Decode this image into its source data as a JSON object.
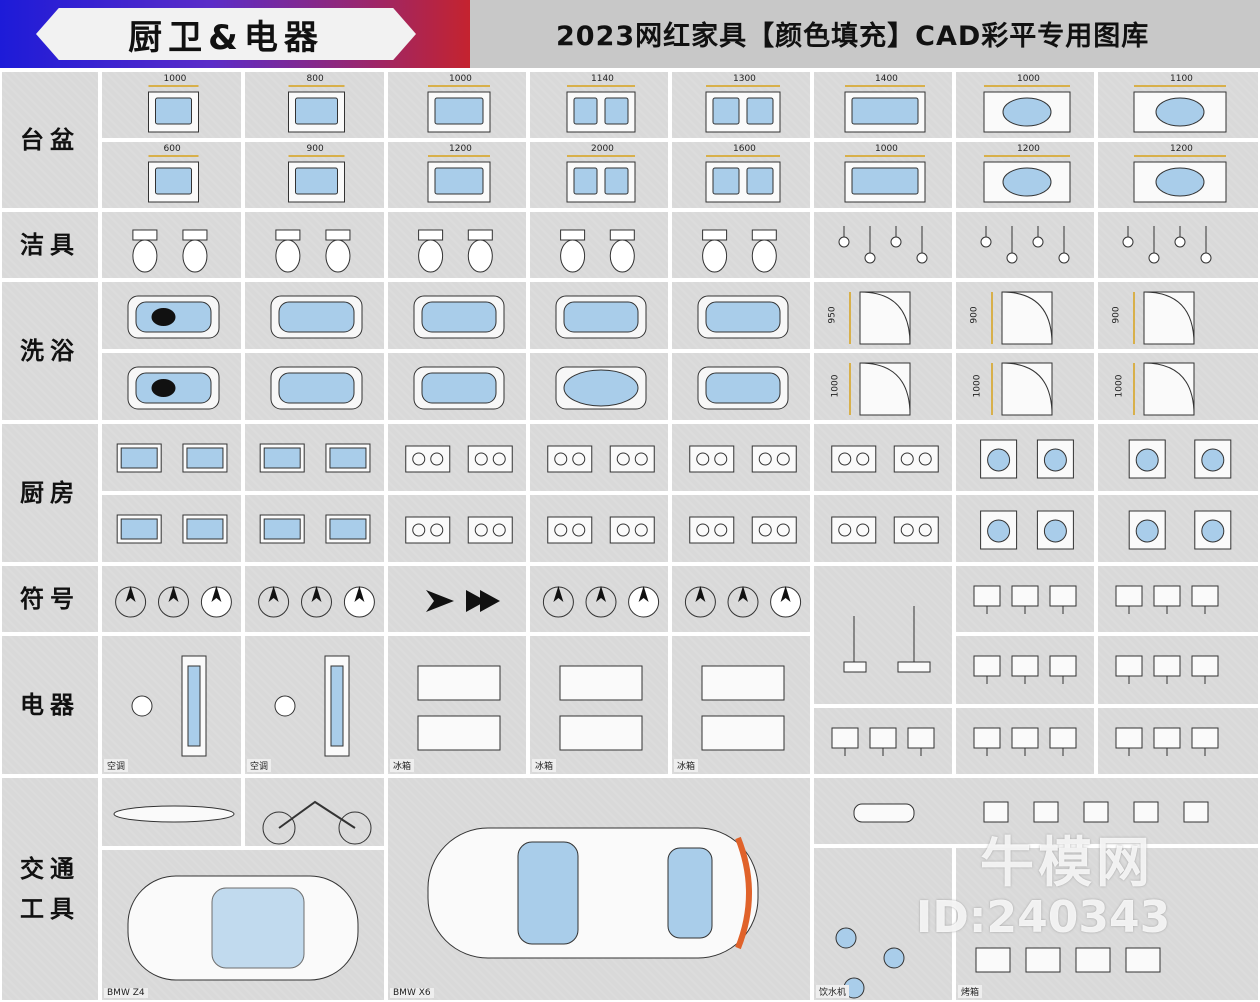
{
  "header": {
    "badge_title": "厨卫&电器",
    "page_title": "2023网红家具【颜色填充】CAD彩平专用图库"
  },
  "rows": {
    "basin": "台盆",
    "sanitary": "洁具",
    "bath": "洗浴",
    "kitchen": "厨房",
    "symbols": "符号",
    "appliances": "电器",
    "transport": "交通工具"
  },
  "basin_dims_top": [
    "1000",
    "800",
    "1000",
    "1140",
    "1300",
    "1400",
    "1000",
    "1100"
  ],
  "basin_dims_bottom": [
    "600",
    "900",
    "1200",
    "2000",
    "1600",
    "1000",
    "1200",
    "1200"
  ],
  "shower_dims": [
    "950",
    "900",
    "900",
    "1000",
    "1000",
    "1000"
  ],
  "appliance_tags": [
    "空调",
    "空调",
    "冰箱",
    "冰箱",
    "冰箱"
  ],
  "transport_tags": [
    "BMW Z4",
    "BMW X6",
    "饮水机",
    "烤箱"
  ],
  "watermark": {
    "brand": "牛模网",
    "id": "ID:240343"
  },
  "colors": {
    "fill_blue": "#a9cdea",
    "cell_bg": "#d9d9d9",
    "accent_orange": "#e0622a"
  }
}
